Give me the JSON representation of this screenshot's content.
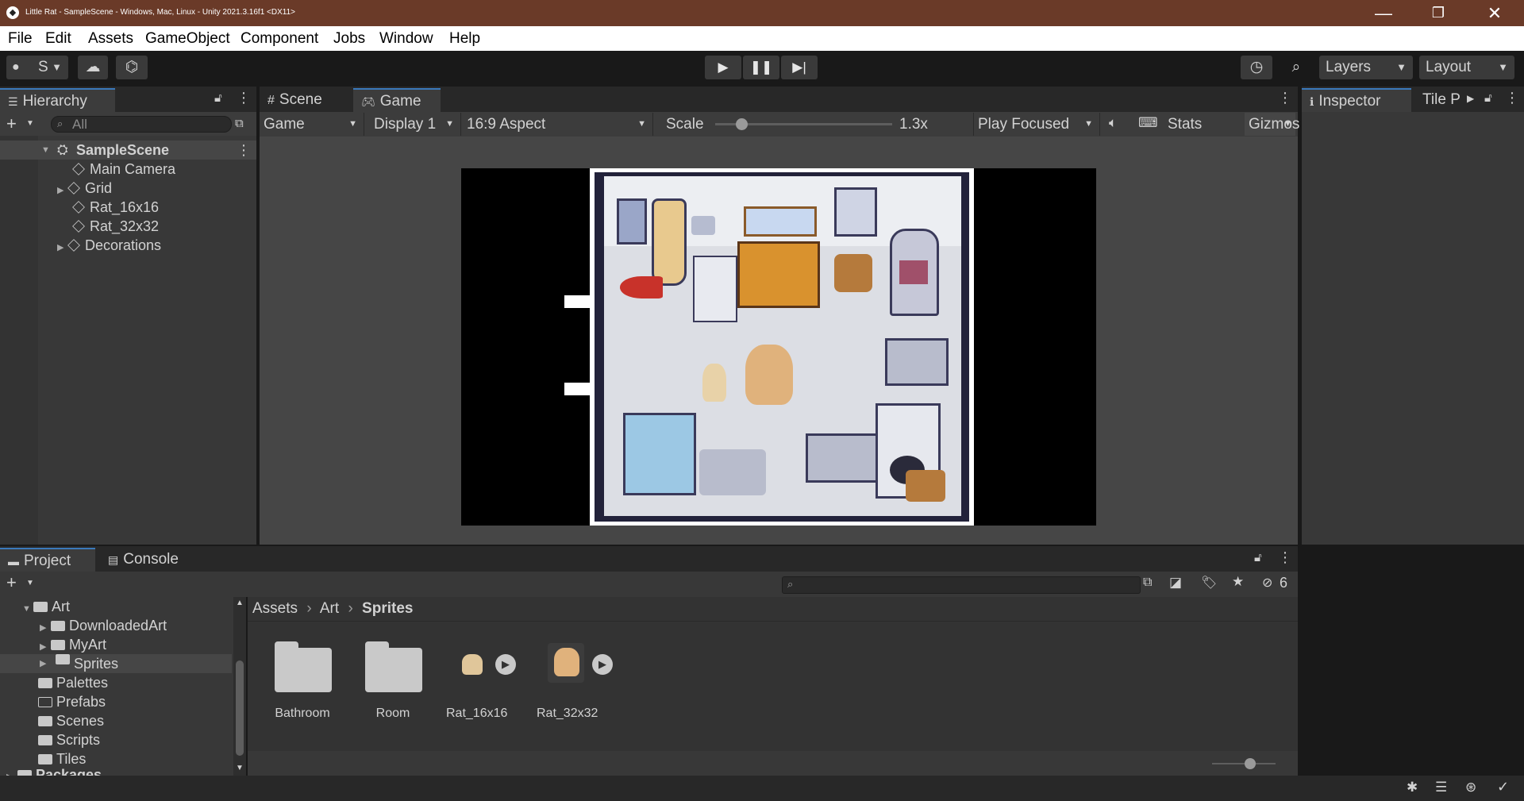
{
  "titlebar": {
    "title": "Little Rat - SampleScene - Windows, Mac, Linux - Unity 2021.3.16f1 <DX11>",
    "minimize": "—",
    "restore": "❐",
    "close": "✕"
  },
  "menu": [
    "File",
    "Edit",
    "Assets",
    "GameObject",
    "Component",
    "Jobs",
    "Window",
    "Help"
  ],
  "toolbar": {
    "account": "S",
    "layers": "Layers",
    "layout": "Layout"
  },
  "hierarchy": {
    "tab": "Hierarchy",
    "search_placeholder": "All",
    "scene": "SampleScene",
    "items": [
      "Main Camera",
      "Grid",
      "Rat_16x16",
      "Rat_32x32",
      "Decorations"
    ]
  },
  "game": {
    "tabs": [
      "Scene",
      "Game"
    ],
    "display_mode": "Game",
    "display": "Display 1",
    "aspect": "16:9 Aspect",
    "scale_label": "Scale",
    "scale_value": "1.3x",
    "scale_fraction": 0.15,
    "play_mode": "Play Focused",
    "stats": "Stats",
    "gizmos": "Gizmos"
  },
  "inspector": {
    "tab": "Inspector",
    "tab2": "Tile P"
  },
  "project": {
    "tabs": [
      "Project",
      "Console"
    ],
    "hidden_count": "6",
    "tree": [
      {
        "label": "Art",
        "expanded": true
      },
      {
        "label": "DownloadedArt"
      },
      {
        "label": "MyArt"
      },
      {
        "label": "Sprites",
        "selected": true
      },
      {
        "label": "Palettes"
      },
      {
        "label": "Prefabs"
      },
      {
        "label": "Scenes"
      },
      {
        "label": "Scripts"
      },
      {
        "label": "Tiles"
      },
      {
        "label": "Packages"
      }
    ],
    "breadcrumb": [
      "Assets",
      "Art",
      "Sprites"
    ],
    "assets": [
      "Bathroom",
      "Room",
      "Rat_16x16",
      "Rat_32x32"
    ]
  },
  "colors": {
    "titlebar": "#6a3a28",
    "selection": "#2c5d87",
    "accent": "#3a79bb"
  }
}
